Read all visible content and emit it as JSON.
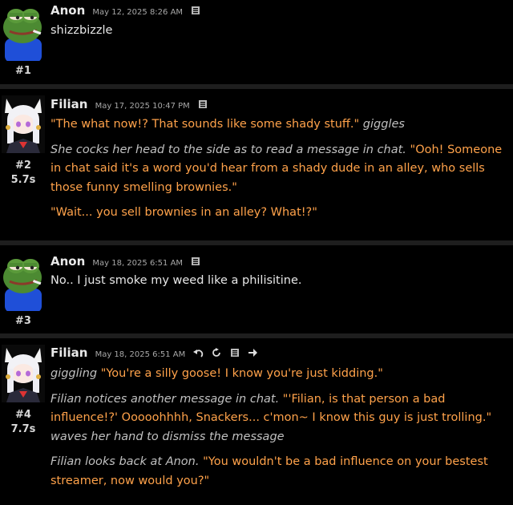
{
  "messages": [
    {
      "author": "Anon",
      "timestamp": "May 12, 2025 8:26 AM",
      "number": "#1",
      "duration": "",
      "avatar": "pepe-frog-icon",
      "paragraphs": [
        [
          {
            "style": "plain",
            "text": "shizzbizzle"
          }
        ]
      ]
    },
    {
      "author": "Filian",
      "timestamp": "May 17, 2025 10:47 PM",
      "number": "#2",
      "duration": "5.7s",
      "avatar": "filian-anime-icon",
      "paragraphs": [
        [
          {
            "style": "hl",
            "text": "\"The what now!? That sounds like some shady stuff.\""
          },
          {
            "style": "em",
            "text": " giggles"
          }
        ],
        [
          {
            "style": "em",
            "text": "She cocks her head to the side as to read a message in chat."
          },
          {
            "style": "hl",
            "text": " \"Ooh! Someone in chat said it's a word you'd hear from a shady dude in an alley, who sells those funny smelling brownies.\""
          }
        ],
        [
          {
            "style": "hl",
            "text": "\"Wait... you sell brownies in an alley? What!?\""
          }
        ]
      ]
    },
    {
      "author": "Anon",
      "timestamp": "May 18, 2025 6:51 AM",
      "number": "#3",
      "duration": "",
      "avatar": "pepe-frog-icon",
      "paragraphs": [
        [
          {
            "style": "plain",
            "text": "No.. I just smoke my weed like a philisitine."
          }
        ]
      ]
    },
    {
      "author": "Filian",
      "timestamp": "May 18, 2025 6:51 AM",
      "number": "#4",
      "duration": "7.7s",
      "avatar": "filian-anime-icon",
      "paragraphs": [
        [
          {
            "style": "em",
            "text": "giggling"
          },
          {
            "style": "hl",
            "text": " \"You're a silly goose! I know you're just kidding.\""
          }
        ],
        [
          {
            "style": "em",
            "text": "Filian notices another message in chat."
          },
          {
            "style": "hl",
            "text": " \"'Filian, is that person a bad influence!?' Ooooohhhh, Snackers... c'mon~ I know this guy is just trolling.\""
          },
          {
            "style": "em",
            "text": " waves her hand to dismiss the message"
          }
        ],
        [
          {
            "style": "em",
            "text": "Filian looks back at Anon."
          },
          {
            "style": "hl",
            "text": " \"You wouldn't be a bad influence on your bestest streamer, now would you?\""
          }
        ]
      ]
    }
  ],
  "icons": {
    "edit": "document-icon",
    "reply": "undo-arrow-icon",
    "regenerate": "refresh-icon",
    "forward": "arrow-right-icon"
  }
}
